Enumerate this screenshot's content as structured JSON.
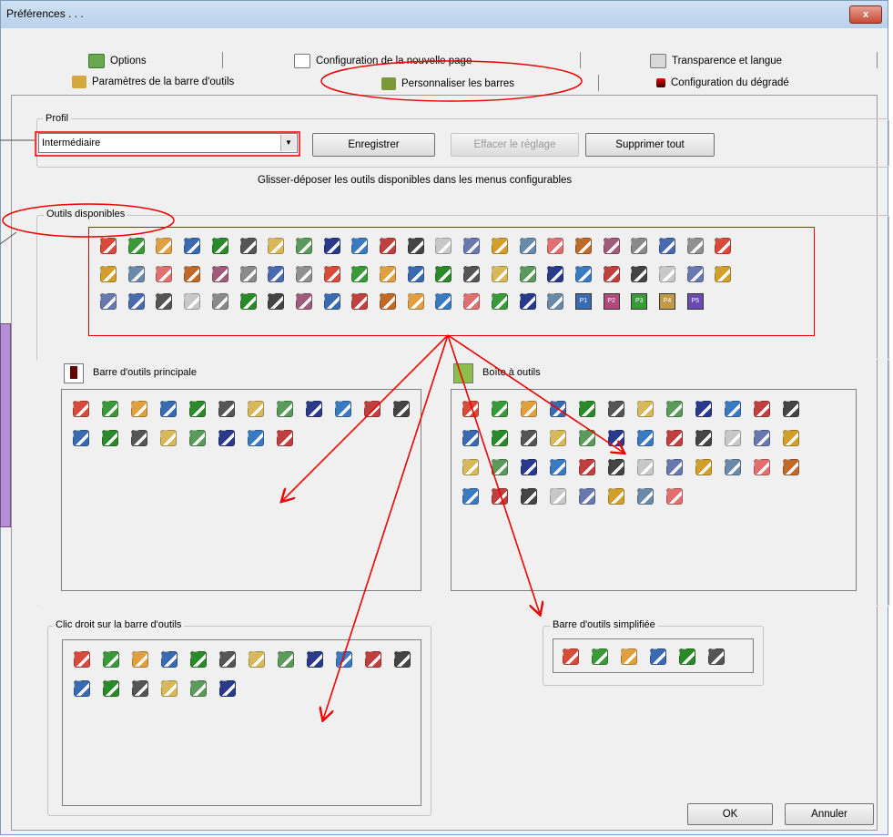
{
  "window": {
    "title": "Préférences . . .",
    "close_label": "x"
  },
  "tabs_row1": [
    {
      "label": "Options",
      "icon": "options-icon"
    },
    {
      "label": "Configuration de la nouvelle page",
      "icon": "page-icon"
    },
    {
      "label": "Transparence et langue",
      "icon": "transparency-icon"
    }
  ],
  "tabs_row2": [
    {
      "label": "Paramètres de la barre d'outils",
      "icon": "wrench-icon"
    },
    {
      "label": "Personnaliser les barres",
      "icon": "customize-icon",
      "active": true
    },
    {
      "label": "Configuration du dégradé",
      "icon": "gradient-icon"
    }
  ],
  "profile": {
    "label": "Profil",
    "value": "Intermédiaire",
    "save": "Enregistrer",
    "clear": "Effacer le réglage",
    "delete_all": "Supprimer tout"
  },
  "instruction": "Glisser-déposer les outils disponibles dans les menus configurables",
  "available": {
    "label": "Outils disponibles",
    "p_labels": [
      "P1",
      "P2",
      "P3",
      "P4",
      "P5"
    ]
  },
  "main_bar": {
    "label": "Barre d'outils principale"
  },
  "toolbox": {
    "label": "Boîte à outils"
  },
  "right_click": {
    "label": "Clic droit sur la barre d'outils"
  },
  "simplified": {
    "label": "Barre d'outils simplifiée"
  },
  "footer": {
    "ok": "OK",
    "cancel": "Annuler"
  },
  "colors": {
    "annotation_red": "#e00000",
    "accent_blue": "#3a6fc4",
    "purple_note": "#b48fd6"
  }
}
